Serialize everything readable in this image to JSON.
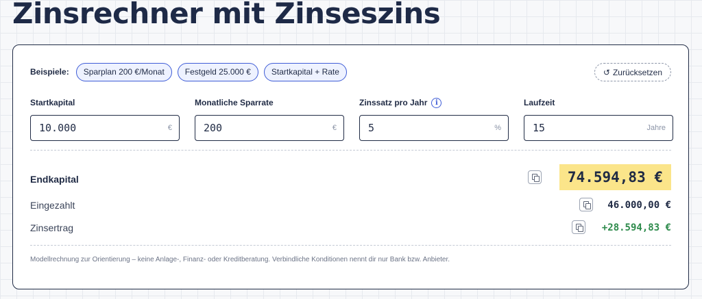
{
  "page": {
    "title": "Zinsrechner mit Zinseszins"
  },
  "examples": {
    "label": "Beispiele:",
    "chips": [
      "Sparplan 200 €/Monat",
      "Festgeld 25.000 €",
      "Startkapital + Rate"
    ]
  },
  "reset": {
    "label": "Zurücksetzen",
    "icon": "reset-icon"
  },
  "fields": [
    {
      "label": "Startkapital",
      "value": "10.000",
      "unit": "€"
    },
    {
      "label": "Monatliche Sparrate",
      "value": "200",
      "unit": "€"
    },
    {
      "label": "Zinssatz pro Jahr",
      "value": "5",
      "unit": "%",
      "info": "i"
    },
    {
      "label": "Laufzeit",
      "value": "15",
      "unit": "Jahre"
    }
  ],
  "results": {
    "endkapital": {
      "label": "Endkapital",
      "value": "74.594,83 €",
      "highlight_color": "#fbe58a"
    },
    "eingezahlt": {
      "label": "Eingezahlt",
      "value": "46.000,00 €"
    },
    "zinsertrag": {
      "label": "Zinsertrag",
      "value": "+28.594,83 €",
      "color": "#2e8b4c"
    }
  },
  "disclaimer": "Modellrechnung zur Orientierung – keine Anlage-, Finanz- oder Kreditberatung. Verbindliche Konditionen nennt dir nur Bank bzw. Anbieter.",
  "colors": {
    "accent": "#3d5bd6",
    "text": "#1f2a44",
    "positive": "#2e8b4c"
  }
}
